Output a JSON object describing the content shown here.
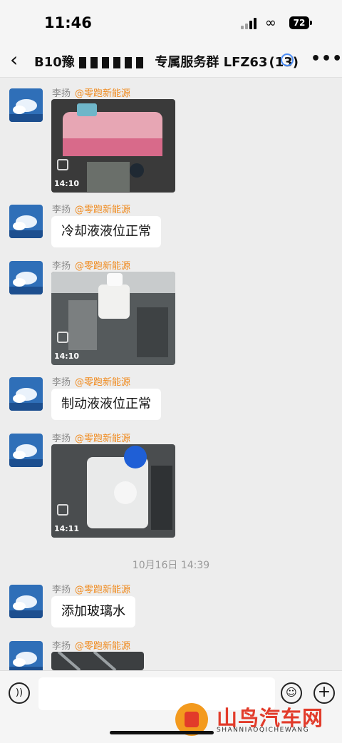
{
  "status_bar": {
    "time": "11:46",
    "battery": "72"
  },
  "header": {
    "title_prefix": "B10豫",
    "title_suffix": "专属服务群 LFZ63",
    "member_count": "(13)"
  },
  "sender": {
    "name": "李扬",
    "org": "@零跑新能源"
  },
  "messages": [
    {
      "type": "image",
      "stamp": "14:10"
    },
    {
      "type": "text",
      "text": "冷却液液位正常"
    },
    {
      "type": "image",
      "stamp": "14:10"
    },
    {
      "type": "text",
      "text": "制动液液位正常"
    },
    {
      "type": "image",
      "stamp": "14:11"
    },
    {
      "type": "text",
      "text": "添加玻璃水"
    },
    {
      "type": "image",
      "stamp": ""
    }
  ],
  "time_divider": "10月16日 14:39",
  "watermark": {
    "cn": "山鸟汽车网",
    "en": "SHANNIAOQICHEWANG"
  },
  "colors": {
    "org": "#f08a1d",
    "background": "#ededed",
    "watermark_red": "#e23b2a"
  }
}
